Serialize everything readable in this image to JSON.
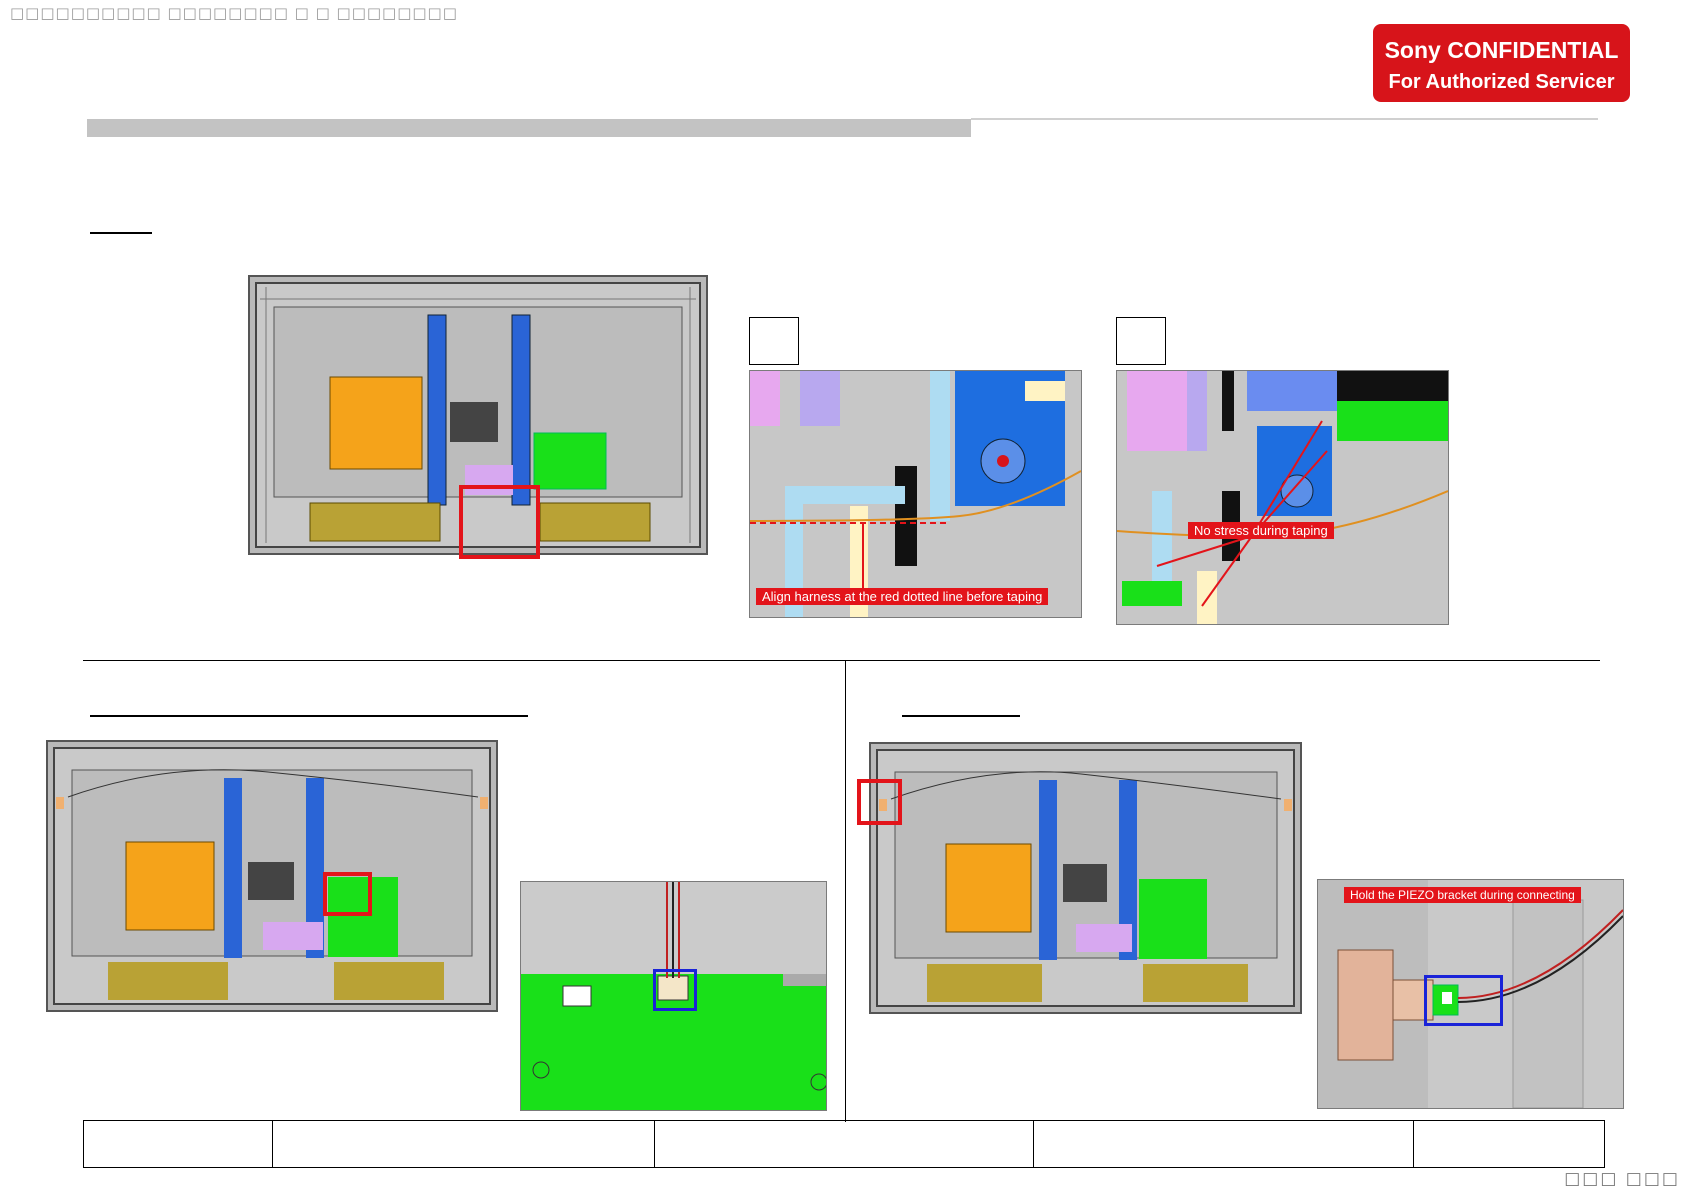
{
  "header": {
    "glyph_title": "□□□□□□□□□□ □□□□□□□□ □ □ □□□□□□□□",
    "confidential_line1": "Sony CONFIDENTIAL",
    "confidential_line2": "For Authorized Servicer"
  },
  "section_top": {
    "detail_a_label": "",
    "detail_b_label": "",
    "note_a": "Align harness at the red dotted line before taping",
    "note_b": "No stress during taping"
  },
  "section_bottom_right": {
    "note": "Hold the PIEZO bracket during connecting"
  },
  "footer": {
    "page_number": "□□□ □□□"
  },
  "colors": {
    "confidential_bg": "#d7141a",
    "highlight_red": "#e3141a",
    "highlight_blue": "#1a23d8",
    "board_green": "#19e019",
    "board_orange": "#f5a31a",
    "bracket_blue": "#2a64d6"
  },
  "icons": [
    "tv-rear-diagram",
    "board-closeup",
    "connector-closeup"
  ]
}
